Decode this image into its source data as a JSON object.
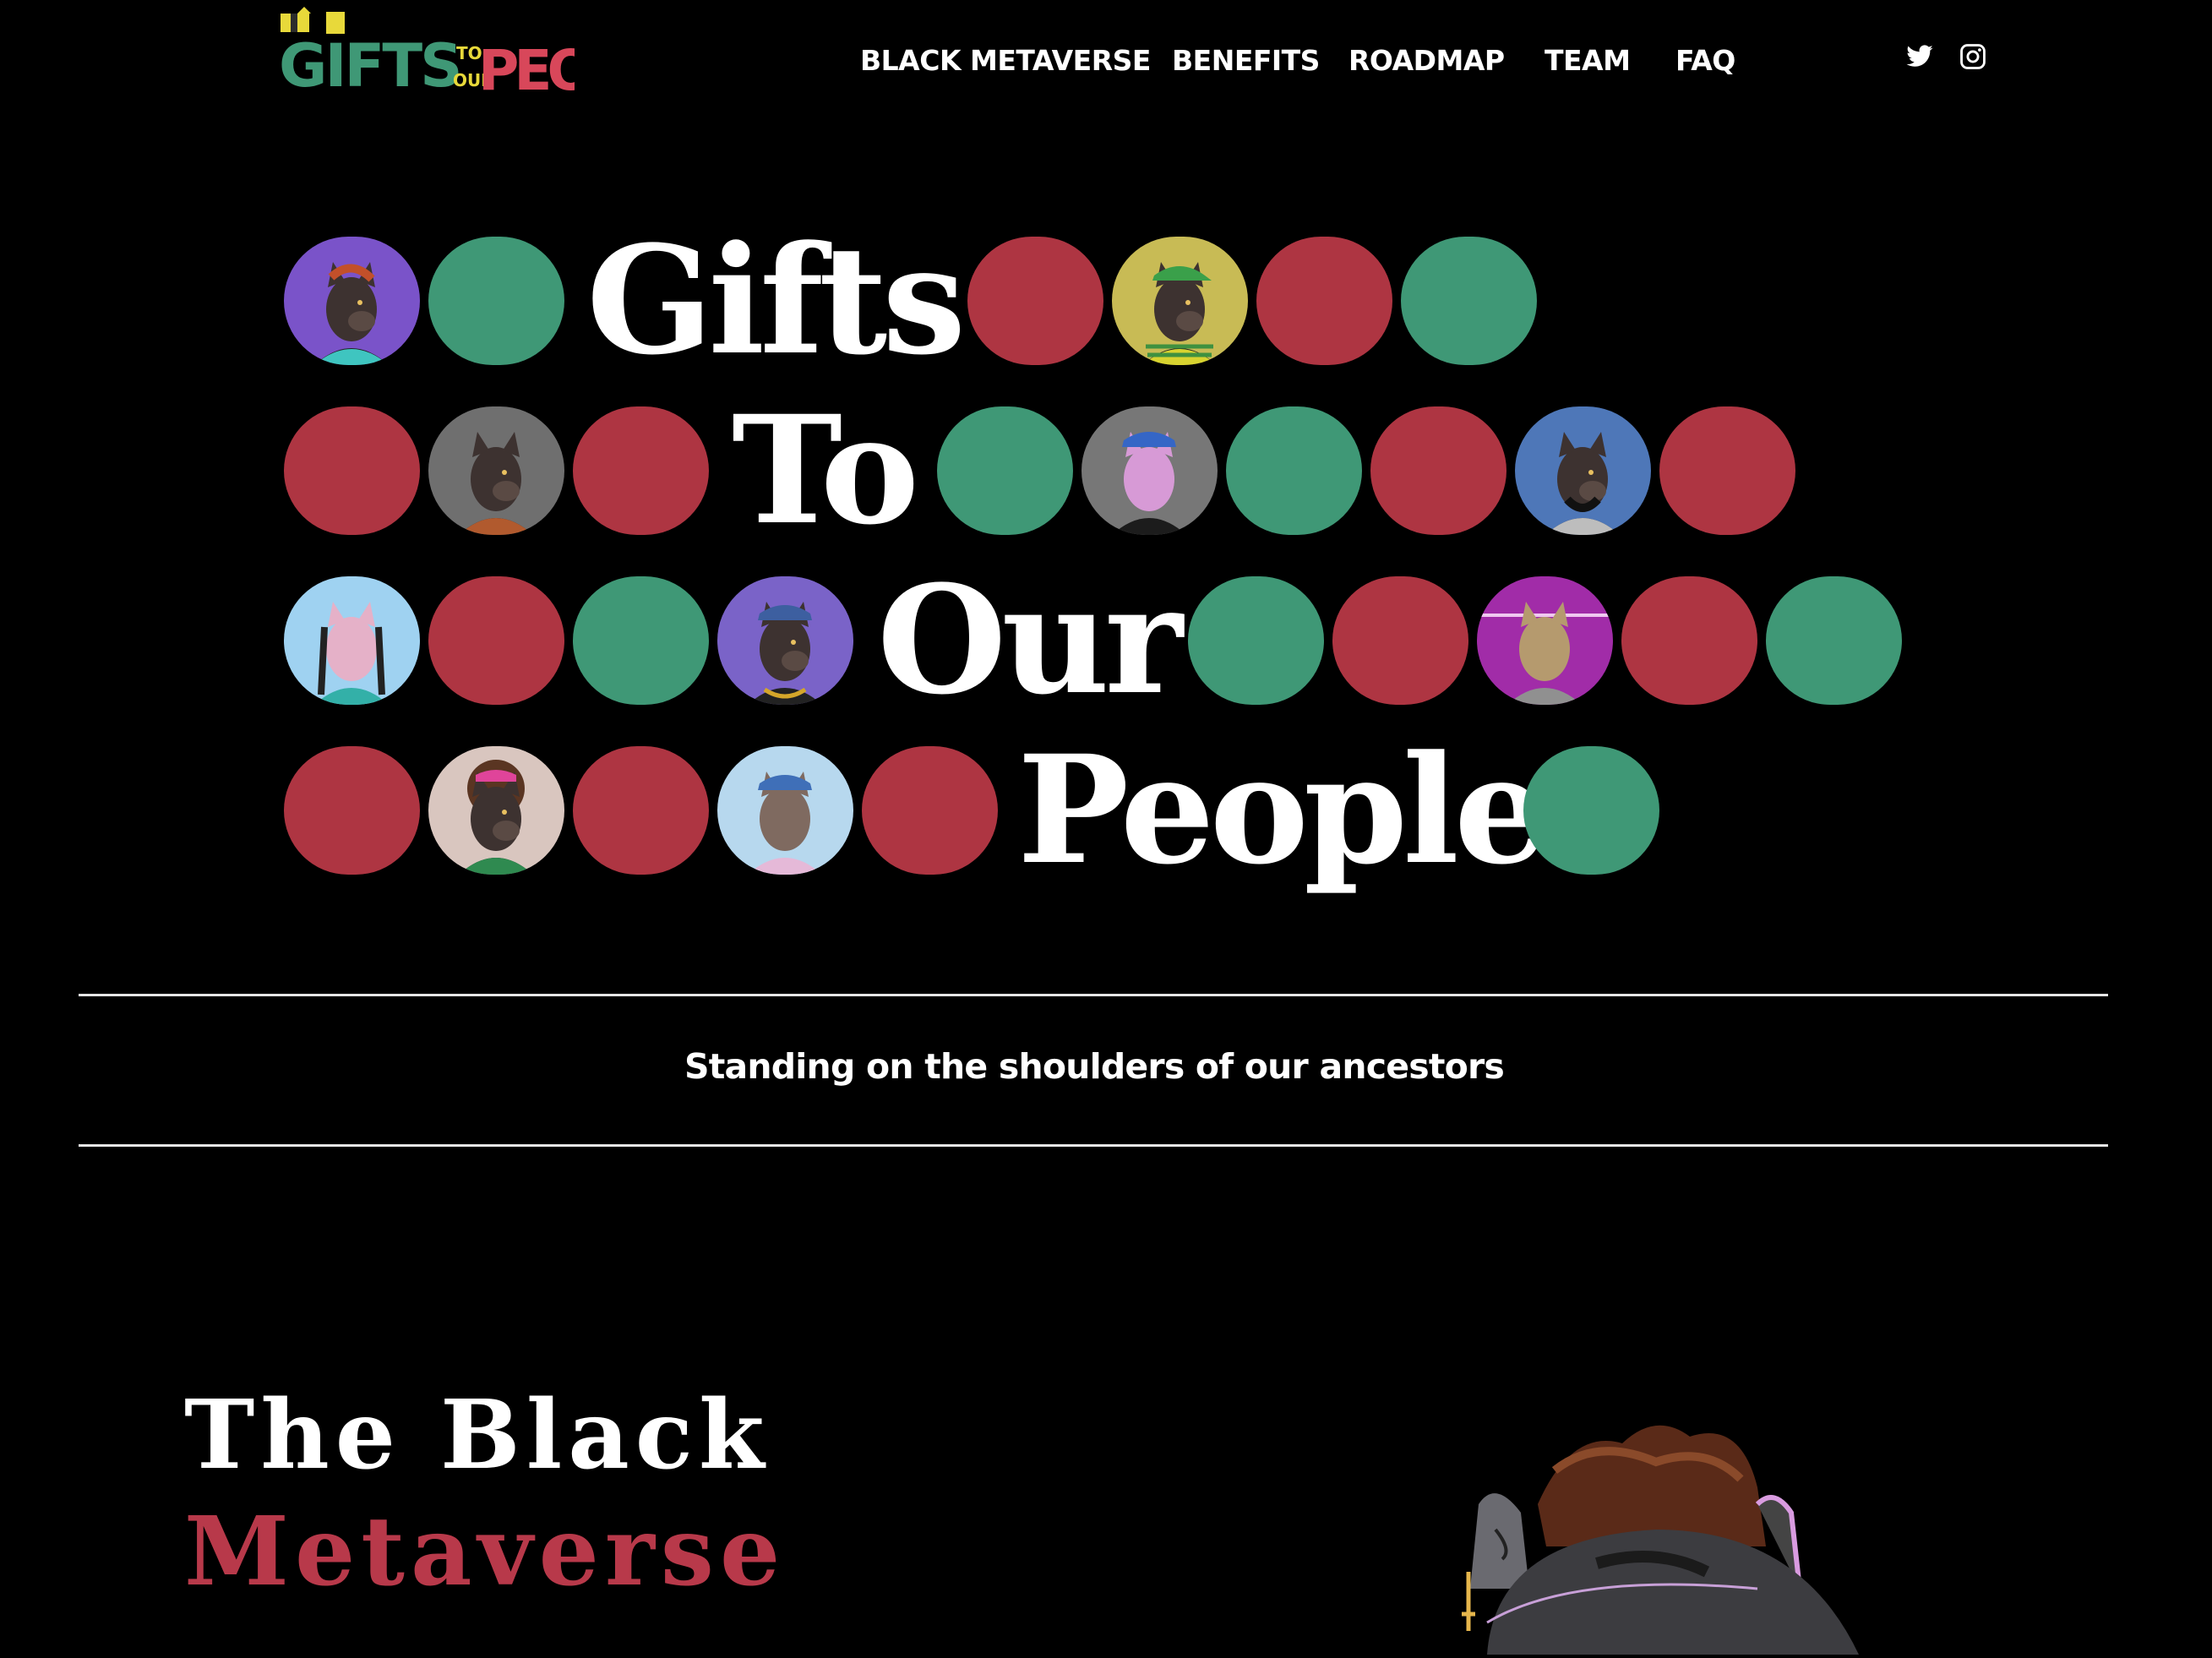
{
  "header": {
    "logo": {
      "words": [
        "GIFTS",
        "TO",
        "OUR",
        "PEOPLE"
      ]
    },
    "nav": [
      {
        "label": "BLACK METAVERSE"
      },
      {
        "label": "BENEFITS"
      },
      {
        "label": "ROADMAP"
      },
      {
        "label": "TEAM"
      },
      {
        "label": "FAQ"
      }
    ],
    "social": [
      "twitter-icon",
      "instagram-icon"
    ]
  },
  "hero": {
    "rows": [
      {
        "word": "Gifts",
        "dots": [
          "avatar",
          "green",
          "word",
          "red",
          "avatar",
          "red",
          "green"
        ]
      },
      {
        "word": "To",
        "dots": [
          "red",
          "avatar",
          "red",
          "word",
          "green",
          "avatar",
          "green",
          "red",
          "avatar",
          "red"
        ]
      },
      {
        "word": "Our",
        "dots": [
          "avatar",
          "red",
          "green",
          "avatar",
          "word",
          "green",
          "red",
          "avatar",
          "red",
          "green"
        ]
      },
      {
        "word": "People",
        "dots": [
          "red",
          "avatar",
          "red",
          "avatar",
          "red",
          "word",
          "green"
        ]
      }
    ],
    "colors": {
      "red": "#ae3542",
      "green": "#3f9876"
    }
  },
  "tagline": "Standing on the shoulders of our ancestors",
  "section": {
    "title_line1": "The Black",
    "title_line2": "Metaverse",
    "accent": "#b8394a"
  }
}
